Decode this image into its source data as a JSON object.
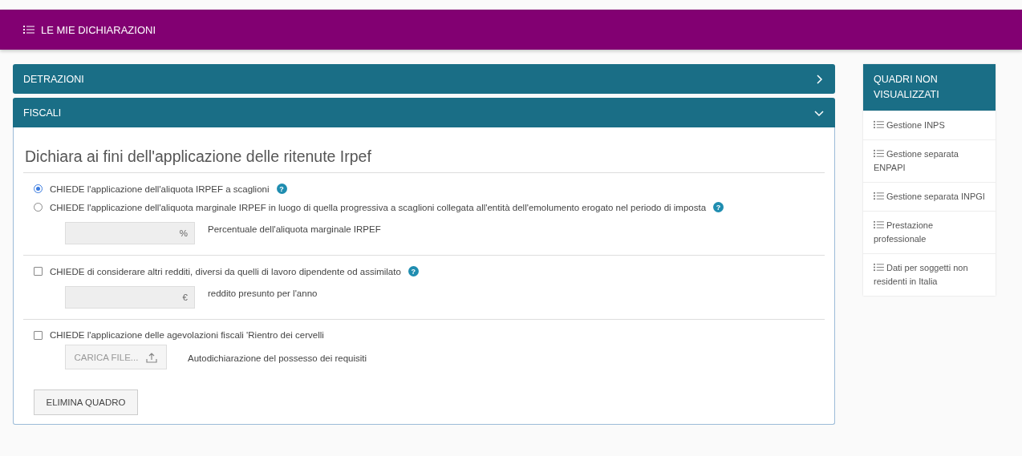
{
  "header": {
    "title": "LE MIE DICHIARAZIONI"
  },
  "panels": [
    {
      "title": "DETRAZIONI",
      "expanded": false
    },
    {
      "title": "FISCALI",
      "expanded": true
    }
  ],
  "form": {
    "heading": "Dichiara ai fini dell'applicazione delle ritenute Irpef",
    "groups": [
      {
        "options": [
          {
            "kind": "radio",
            "selected": true,
            "label": "CHIEDE l'applicazione dell'aliquota IRPEF a scaglioni",
            "help": "?"
          },
          {
            "kind": "radio",
            "selected": false,
            "label": "CHIEDE l'applicazione dell'aliquota marginale IRPEF in luogo di quella progressiva a scaglioni collegata all'entità dell'emolumento erogato nel periodo di imposta",
            "help": "?",
            "field": {
              "suffix": "%",
              "label": "Percentuale dell'aliquota marginale IRPEF"
            }
          }
        ]
      },
      {
        "options": [
          {
            "kind": "checkbox",
            "checked": false,
            "label": "CHIEDE di considerare altri redditi, diversi da quelli di lavoro dipendente od assimilato",
            "help": "?",
            "field": {
              "suffix": "€",
              "label": "reddito presunto per l'anno"
            }
          }
        ]
      },
      {
        "options": [
          {
            "kind": "checkbox",
            "checked": false,
            "label": "CHIEDE l'applicazione delle agevolazioni fiscali 'Rientro dei cervelli",
            "upload": {
              "button": "CARICA FILE...",
              "label": "Autodichiarazione del possesso dei requisiti"
            }
          }
        ]
      }
    ],
    "delete_button": "ELIMINA QUADRO"
  },
  "sidebar": {
    "title": "QUADRI NON VISUALIZZATI",
    "items": [
      "Gestione INPS",
      "Gestione separata ENPAPI",
      "Gestione separata INPGI",
      "Prestazione professionale",
      "Dati per soggetti non residenti in Italia"
    ]
  }
}
